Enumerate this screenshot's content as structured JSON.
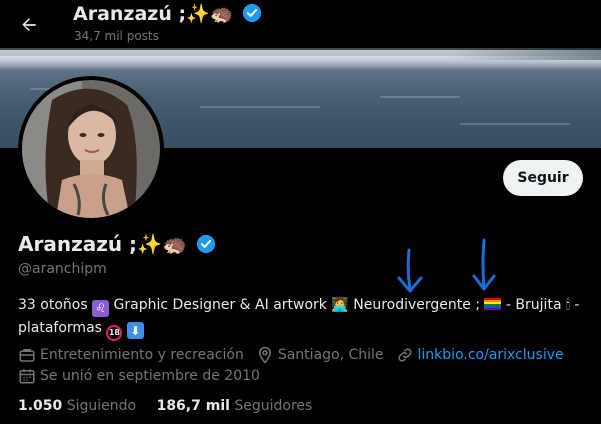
{
  "header": {
    "title": "Aranzazú ;✨🦔",
    "post_count": "34,7 mil posts"
  },
  "profile": {
    "name": "Aranzazú ;✨🦔",
    "handle": "@aranchipm",
    "follow_label": "Seguir",
    "bio": {
      "part1": "33 otoños ",
      "leo_symbol": "♌",
      "part2": " Graphic Designer & AI artwork ",
      "laptop_emoji": "🧑‍💻",
      "part3": " Neurodivergente ; ",
      "part4": " - Brujita ",
      "candle_emoji": "🕯",
      "part5": " - plataformas ",
      "eighteen": "18",
      "down_arrow": "⬇"
    },
    "category": "Entretenimiento y recreación",
    "location": "Santiago, Chile",
    "link": "linkbio.co/arixclusive",
    "joined": "Se unió en septiembre de 2010",
    "following_count": "1.050",
    "following_label": "Siguiendo",
    "followers_count": "186,7 mil",
    "followers_label": "Seguidores"
  },
  "colors": {
    "accent": "#1d9bf0",
    "background": "#000000",
    "secondary_text": "#71767b",
    "annotation_arrow": "#1a6fd6"
  },
  "icons": [
    "back-arrow-icon",
    "verified-badge-icon",
    "briefcase-icon",
    "location-pin-icon",
    "link-icon",
    "calendar-icon"
  ]
}
